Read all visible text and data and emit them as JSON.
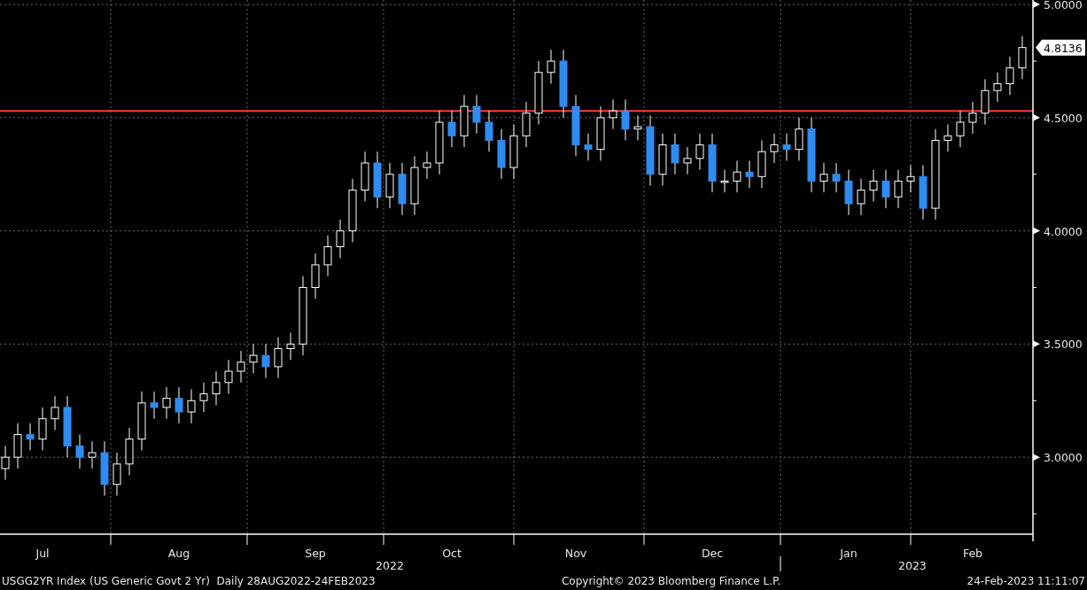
{
  "chart": {
    "chart_data": {
      "type": "candlestick",
      "grid": true,
      "ylim": [
        2.66,
        5.02
      ],
      "yticks": [
        {
          "value": 3,
          "label": "3.0000"
        },
        {
          "value": 3.5,
          "label": "3.5000"
        },
        {
          "value": 4,
          "label": "4.0000"
        },
        {
          "value": 4.5,
          "label": "4.5000"
        },
        {
          "value": 5,
          "label": "5.0000"
        }
      ],
      "categories": [
        null,
        null,
        null,
        "Jul",
        null,
        null,
        null,
        null,
        null,
        null,
        null,
        null,
        null,
        null,
        "Aug",
        null,
        null,
        null,
        null,
        null,
        null,
        null,
        null,
        null,
        null,
        "Sep",
        null,
        null,
        null,
        null,
        null,
        null,
        null,
        null,
        null,
        null,
        "Oct",
        null,
        null,
        null,
        null,
        null,
        null,
        null,
        null,
        null,
        "Nov",
        null,
        null,
        null,
        null,
        null,
        null,
        null,
        null,
        null,
        null,
        "Dec",
        null,
        null,
        null,
        null,
        null,
        null,
        null,
        null,
        null,
        null,
        "Jan",
        null,
        null,
        null,
        null,
        null,
        null,
        null,
        null,
        null,
        "Feb",
        null,
        null,
        null,
        null
      ],
      "ohlc": [
        [
          2.95,
          3.05,
          2.9,
          3.0
        ],
        [
          3.0,
          3.15,
          2.95,
          3.1
        ],
        [
          3.1,
          3.15,
          3.03,
          3.08
        ],
        [
          3.08,
          3.22,
          3.03,
          3.17
        ],
        [
          3.17,
          3.27,
          3.12,
          3.22
        ],
        [
          3.22,
          3.27,
          3.0,
          3.05
        ],
        [
          3.05,
          3.1,
          2.95,
          3.0
        ],
        [
          3.0,
          3.07,
          2.95,
          3.02
        ],
        [
          3.02,
          3.07,
          2.83,
          2.88
        ],
        [
          2.88,
          3.02,
          2.83,
          2.97
        ],
        [
          2.97,
          3.13,
          2.92,
          3.08
        ],
        [
          3.08,
          3.29,
          3.03,
          3.24
        ],
        [
          3.24,
          3.29,
          3.17,
          3.22
        ],
        [
          3.22,
          3.31,
          3.17,
          3.26
        ],
        [
          3.26,
          3.31,
          3.15,
          3.2
        ],
        [
          3.2,
          3.3,
          3.15,
          3.25
        ],
        [
          3.25,
          3.33,
          3.2,
          3.28
        ],
        [
          3.28,
          3.38,
          3.23,
          3.33
        ],
        [
          3.33,
          3.43,
          3.28,
          3.38
        ],
        [
          3.38,
          3.47,
          3.33,
          3.42
        ],
        [
          3.42,
          3.5,
          3.37,
          3.45
        ],
        [
          3.45,
          3.5,
          3.35,
          3.4
        ],
        [
          3.4,
          3.53,
          3.35,
          3.48
        ],
        [
          3.48,
          3.55,
          3.43,
          3.5
        ],
        [
          3.5,
          3.8,
          3.45,
          3.75
        ],
        [
          3.75,
          3.9,
          3.7,
          3.85
        ],
        [
          3.85,
          3.98,
          3.8,
          3.93
        ],
        [
          3.93,
          4.05,
          3.88,
          4.0
        ],
        [
          4.0,
          4.23,
          3.95,
          4.18
        ],
        [
          4.18,
          4.35,
          4.13,
          4.3
        ],
        [
          4.3,
          4.35,
          4.1,
          4.15
        ],
        [
          4.15,
          4.3,
          4.1,
          4.25
        ],
        [
          4.25,
          4.3,
          4.07,
          4.12
        ],
        [
          4.12,
          4.33,
          4.07,
          4.28
        ],
        [
          4.28,
          4.35,
          4.23,
          4.3
        ],
        [
          4.3,
          4.53,
          4.25,
          4.48
        ],
        [
          4.48,
          4.53,
          4.37,
          4.42
        ],
        [
          4.42,
          4.6,
          4.37,
          4.55
        ],
        [
          4.55,
          4.6,
          4.43,
          4.48
        ],
        [
          4.48,
          4.53,
          4.35,
          4.4
        ],
        [
          4.4,
          4.45,
          4.23,
          4.28
        ],
        [
          4.28,
          4.47,
          4.23,
          4.42
        ],
        [
          4.42,
          4.57,
          4.37,
          4.52
        ],
        [
          4.52,
          4.75,
          4.47,
          4.7
        ],
        [
          4.7,
          4.8,
          4.65,
          4.75
        ],
        [
          4.75,
          4.8,
          4.5,
          4.55
        ],
        [
          4.55,
          4.6,
          4.33,
          4.38
        ],
        [
          4.38,
          4.43,
          4.31,
          4.36
        ],
        [
          4.36,
          4.55,
          4.31,
          4.5
        ],
        [
          4.5,
          4.58,
          4.45,
          4.53
        ],
        [
          4.53,
          4.58,
          4.4,
          4.45
        ],
        [
          4.45,
          4.51,
          4.4,
          4.46
        ],
        [
          4.46,
          4.51,
          4.2,
          4.25
        ],
        [
          4.25,
          4.43,
          4.2,
          4.38
        ],
        [
          4.38,
          4.43,
          4.25,
          4.3
        ],
        [
          4.3,
          4.37,
          4.25,
          4.32
        ],
        [
          4.32,
          4.43,
          4.27,
          4.38
        ],
        [
          4.38,
          4.43,
          4.17,
          4.22
        ],
        [
          4.22,
          4.27,
          4.17,
          4.22
        ],
        [
          4.22,
          4.31,
          4.17,
          4.26
        ],
        [
          4.26,
          4.31,
          4.19,
          4.24
        ],
        [
          4.24,
          4.4,
          4.19,
          4.35
        ],
        [
          4.35,
          4.43,
          4.3,
          4.38
        ],
        [
          4.38,
          4.43,
          4.31,
          4.36
        ],
        [
          4.36,
          4.5,
          4.31,
          4.45
        ],
        [
          4.45,
          4.5,
          4.17,
          4.22
        ],
        [
          4.22,
          4.3,
          4.17,
          4.25
        ],
        [
          4.25,
          4.3,
          4.17,
          4.22
        ],
        [
          4.22,
          4.27,
          4.07,
          4.12
        ],
        [
          4.12,
          4.23,
          4.07,
          4.18
        ],
        [
          4.18,
          4.27,
          4.13,
          4.22
        ],
        [
          4.22,
          4.27,
          4.1,
          4.15
        ],
        [
          4.15,
          4.27,
          4.1,
          4.22
        ],
        [
          4.22,
          4.29,
          4.17,
          4.24
        ],
        [
          4.24,
          4.29,
          4.05,
          4.1
        ],
        [
          4.1,
          4.45,
          4.05,
          4.4
        ],
        [
          4.4,
          4.47,
          4.35,
          4.42
        ],
        [
          4.42,
          4.53,
          4.37,
          4.48
        ],
        [
          4.48,
          4.57,
          4.43,
          4.52
        ],
        [
          4.52,
          4.67,
          4.47,
          4.62
        ],
        [
          4.62,
          4.7,
          4.57,
          4.65
        ],
        [
          4.65,
          4.77,
          4.6,
          4.72
        ],
        [
          4.72,
          4.86,
          4.67,
          4.81
        ]
      ],
      "ref_lines": [
        {
          "axis": "y",
          "value": 4.53,
          "color": "#ff3b3b"
        }
      ],
      "annotations": [
        "4.8136",
        "2022",
        "2023"
      ]
    }
  },
  "footer": {
    "security": "USGG2YR Index (US Generic Govt 2 Yr)  Daily 28AUG2022-24FEB2023",
    "copyright": "Copyright© 2023 Bloomberg Finance L.P.",
    "timestamp": "24-Feb-2023 11:11:07"
  }
}
